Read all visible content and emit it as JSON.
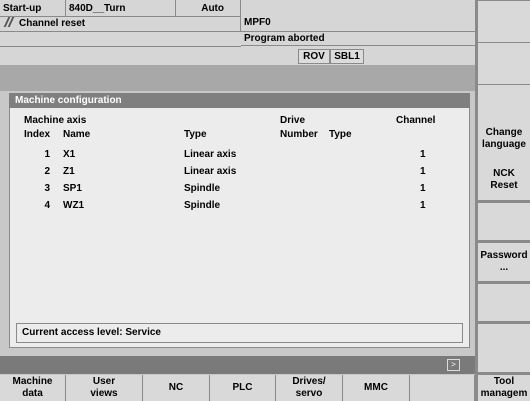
{
  "header": {
    "area": "Start-up",
    "machine": "840D__Turn",
    "mode": "Auto",
    "program": "MPF0",
    "channel_status": "Channel reset",
    "program_status": "Program aborted",
    "flags": [
      "ROV",
      "SBL1"
    ]
  },
  "panel": {
    "title": "Machine configuration",
    "col_machine_axis": "Machine axis",
    "col_index": "Index",
    "col_name": "Name",
    "col_type": "Type",
    "col_drive": "Drive",
    "col_number": "Number",
    "col_drive_type": "Type",
    "col_channel": "Channel",
    "rows": [
      {
        "index": "1",
        "name": "X1",
        "type": "Linear axis",
        "channel": "1"
      },
      {
        "index": "2",
        "name": "Z1",
        "type": "Linear axis",
        "channel": "1"
      },
      {
        "index": "3",
        "name": "SP1",
        "type": "Spindle",
        "channel": "1"
      },
      {
        "index": "4",
        "name": "WZ1",
        "type": "Spindle",
        "channel": "1"
      }
    ]
  },
  "access_level": "Current access level: Service",
  "etc_symbol": ">",
  "horizontal_softkeys": [
    [
      "Machine",
      "data"
    ],
    [
      "User",
      "views"
    ],
    [
      "NC",
      ""
    ],
    [
      "PLC",
      ""
    ],
    [
      "Drives/",
      "servo"
    ],
    [
      "MMC",
      ""
    ],
    [
      "",
      ""
    ]
  ],
  "vertical_softkeys": [
    [
      "",
      ""
    ],
    [
      "",
      ""
    ],
    [
      "Change",
      "language"
    ],
    [
      "NCK",
      "Reset"
    ],
    [
      "",
      ""
    ],
    [
      "Password",
      "..."
    ],
    [
      "",
      ""
    ],
    [
      "",
      ""
    ],
    [
      "Tool",
      "managem"
    ]
  ]
}
